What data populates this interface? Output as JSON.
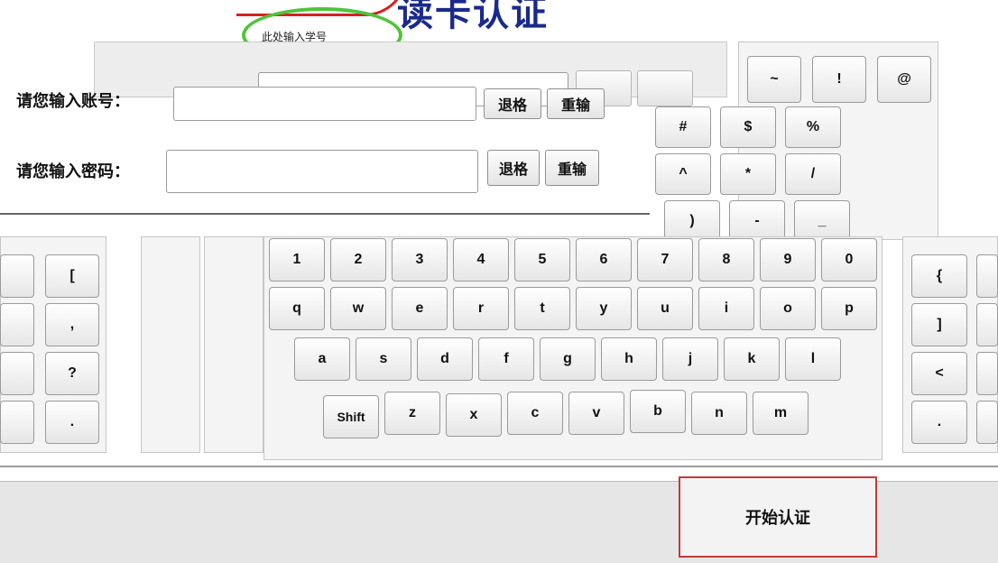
{
  "header": {
    "title": "读卡认证",
    "hint": "此处输入学号"
  },
  "form": {
    "account_label": "请您输入账号：",
    "password_label": "请您输入密码：",
    "account_value": "",
    "password_value": "",
    "backspace_label": "退格",
    "reenter_label": "重输"
  },
  "symbols_right": {
    "row1": [
      "~",
      "!",
      "@"
    ],
    "row2": [
      "#",
      "$",
      "%"
    ],
    "row3": [
      "^",
      "*",
      "/"
    ],
    "row4": [
      ")",
      "-",
      "_"
    ]
  },
  "keyboard": {
    "numbers": [
      "1",
      "2",
      "3",
      "4",
      "5",
      "6",
      "7",
      "8",
      "9",
      "0"
    ],
    "row_q": [
      "q",
      "w",
      "e",
      "r",
      "t",
      "y",
      "u",
      "i",
      "o",
      "p"
    ],
    "row_a": [
      "a",
      "s",
      "d",
      "f",
      "g",
      "h",
      "j",
      "k",
      "l"
    ],
    "row_z": [
      "Shift",
      "z",
      "x",
      "c",
      "v",
      "b",
      "n",
      "m"
    ],
    "left_col": [
      "[",
      ",",
      "?",
      "."
    ],
    "right_col": [
      "{",
      "]",
      "<",
      "."
    ]
  },
  "actions": {
    "start_label": "开始认证"
  }
}
